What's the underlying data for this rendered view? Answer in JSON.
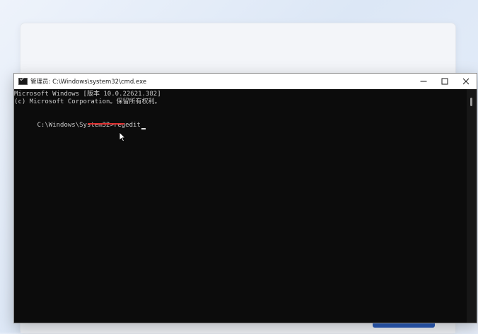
{
  "window": {
    "title": "管理员: C:\\Windows\\system32\\cmd.exe",
    "icon": "cmd-icon"
  },
  "caption_buttons": {
    "minimize": "minimize-icon",
    "maximize": "maximize-icon",
    "close": "close-icon"
  },
  "console": {
    "line1": "Microsoft Windows [版本 10.0.22621.382]",
    "line2": "(c) Microsoft Corporation。保留所有权利。",
    "prompt": "C:\\Windows\\System32>",
    "command": "regedit"
  },
  "annotation": {
    "underline_color": "#e03030"
  }
}
